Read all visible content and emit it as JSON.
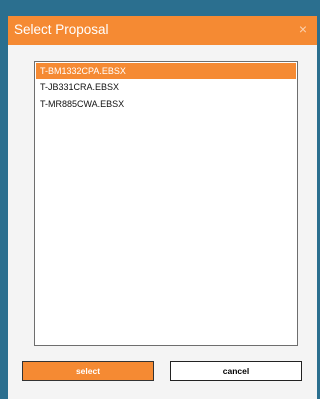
{
  "dialog": {
    "title": "Select Proposal",
    "close_icon": "close-icon",
    "close_glyph": "×"
  },
  "proposals": {
    "items": [
      "T-BM1332CPA.EBSX",
      "T-JB331CRA.EBSX",
      "T-MR885CWA.EBSX"
    ],
    "selected_index": 0
  },
  "buttons": {
    "select_label": "select",
    "cancel_label": "cancel"
  },
  "colors": {
    "accent": "#f58a33",
    "background": "#2b6f8f",
    "dialog": "#f4f4f4"
  }
}
